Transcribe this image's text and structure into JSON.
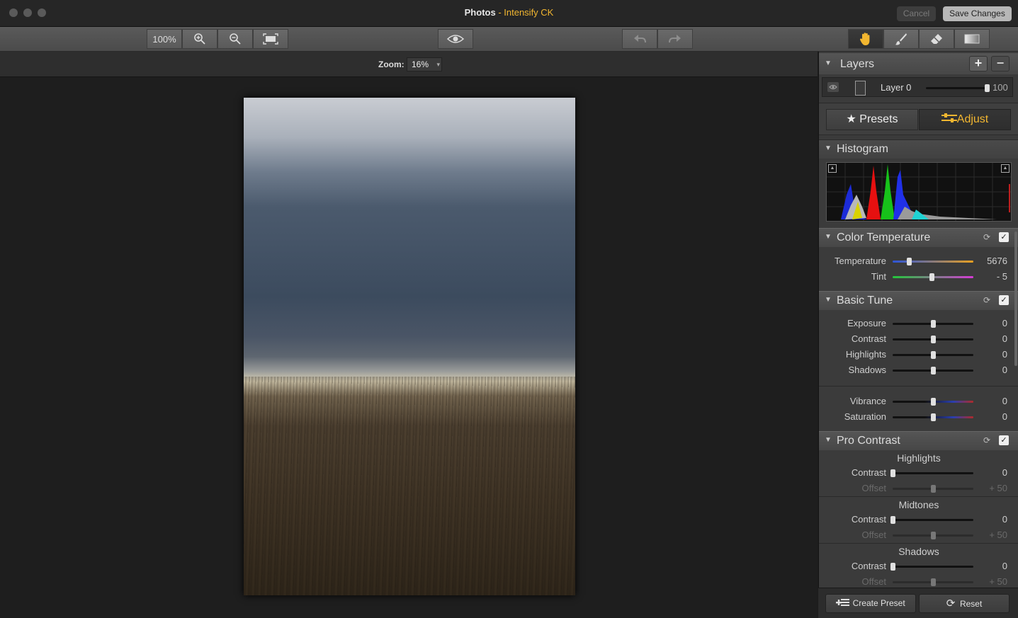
{
  "window": {
    "app": "Photos",
    "separator": " - ",
    "plugin": "Intensify CK",
    "cancel_label": "Cancel",
    "save_label": "Save Changes"
  },
  "toolbar": {
    "zoom_100_label": "100%",
    "zoom_in_icon": "zoom-in-icon",
    "zoom_out_icon": "zoom-out-icon",
    "fit_icon": "fit-screen-icon",
    "preview_icon": "eye-icon",
    "undo_icon": "undo-icon",
    "redo_icon": "redo-icon",
    "tools": [
      "hand-tool-icon",
      "brush-tool-icon",
      "eraser-tool-icon",
      "gradient-tool-icon"
    ]
  },
  "zoom": {
    "label": "Zoom:",
    "value": "16%"
  },
  "layers": {
    "title": "Layers",
    "add": "+",
    "remove": "−",
    "layer_name": "Layer 0",
    "opacity": "100",
    "opacity_level": 1.0
  },
  "tabs": {
    "presets": "Presets",
    "adjust": "Adjust"
  },
  "histogram": {
    "title": "Histogram"
  },
  "color_temperature": {
    "title": "Color Temperature",
    "sliders": [
      {
        "label": "Temperature",
        "value": "5676",
        "level": 0.2
      },
      {
        "label": "Tint",
        "value": "- 5",
        "level": 0.48
      }
    ]
  },
  "basic_tune": {
    "title": "Basic Tune",
    "sliders": [
      {
        "label": "Exposure",
        "value": "0",
        "level": 0.5
      },
      {
        "label": "Contrast",
        "value": "0",
        "level": 0.5
      },
      {
        "label": "Highlights",
        "value": "0",
        "level": 0.5
      },
      {
        "label": "Shadows",
        "value": "0",
        "level": 0.5
      },
      {
        "label": "Vibrance",
        "value": "0",
        "level": 0.5
      },
      {
        "label": "Saturation",
        "value": "0",
        "level": 0.5
      }
    ]
  },
  "pro_contrast": {
    "title": "Pro Contrast",
    "groups": [
      {
        "title": "Highlights",
        "contrast_label": "Contrast",
        "contrast_value": "0",
        "offset_label": "Offset",
        "offset_value": "+ 50"
      },
      {
        "title": "Midtones",
        "contrast_label": "Contrast",
        "contrast_value": "0",
        "offset_label": "Offset",
        "offset_value": "+ 50"
      },
      {
        "title": "Shadows",
        "contrast_label": "Contrast",
        "contrast_value": "0",
        "offset_label": "Offset",
        "offset_value": "+ 50"
      }
    ]
  },
  "footer": {
    "create_preset": "Create Preset",
    "reset": "Reset"
  },
  "colors": {
    "accent": "#f2b630",
    "panel": "#3b3b3b"
  }
}
